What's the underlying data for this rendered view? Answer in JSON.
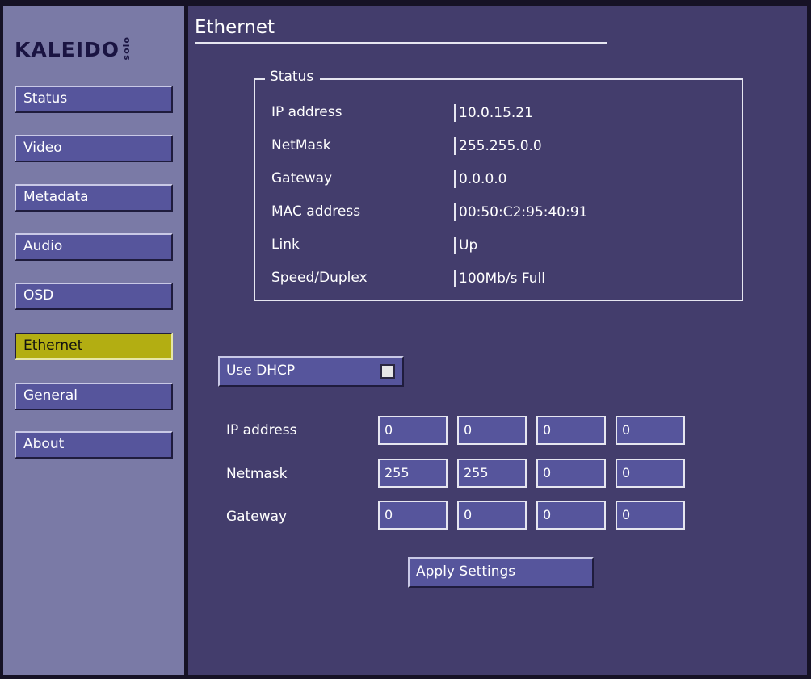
{
  "logo": {
    "main": "KALEIDO",
    "sub": "solo"
  },
  "nav": [
    {
      "label": "Status",
      "active": false
    },
    {
      "label": "Video",
      "active": false
    },
    {
      "label": "Metadata",
      "active": false
    },
    {
      "label": "Audio",
      "active": false
    },
    {
      "label": "OSD",
      "active": false
    },
    {
      "label": "Ethernet",
      "active": true
    },
    {
      "label": "General",
      "active": false
    },
    {
      "label": "About",
      "active": false
    }
  ],
  "page": {
    "title": "Ethernet"
  },
  "status": {
    "legend": "Status",
    "rows": [
      {
        "label": "IP address",
        "value": "10.0.15.21"
      },
      {
        "label": "NetMask",
        "value": "255.255.0.0"
      },
      {
        "label": "Gateway",
        "value": "0.0.0.0"
      },
      {
        "label": "MAC address",
        "value": "00:50:C2:95:40:91"
      },
      {
        "label": "Link",
        "value": "Up"
      },
      {
        "label": "Speed/Duplex",
        "value": "100Mb/s  Full"
      }
    ]
  },
  "dhcp": {
    "label": "Use DHCP",
    "checked": false
  },
  "config": {
    "ip": {
      "label": "IP address",
      "octets": [
        "0",
        "0",
        "0",
        "0"
      ]
    },
    "netmask": {
      "label": "Netmask",
      "octets": [
        "255",
        "255",
        "0",
        "0"
      ]
    },
    "gateway": {
      "label": "Gateway",
      "octets": [
        "0",
        "0",
        "0",
        "0"
      ]
    }
  },
  "apply": {
    "label": "Apply Settings"
  },
  "colors": {
    "sidebar": "#7a7aa6",
    "main": "#433d6c",
    "button": "#56559c",
    "active_button": "#b3ae12",
    "logo": "#1a1442"
  }
}
